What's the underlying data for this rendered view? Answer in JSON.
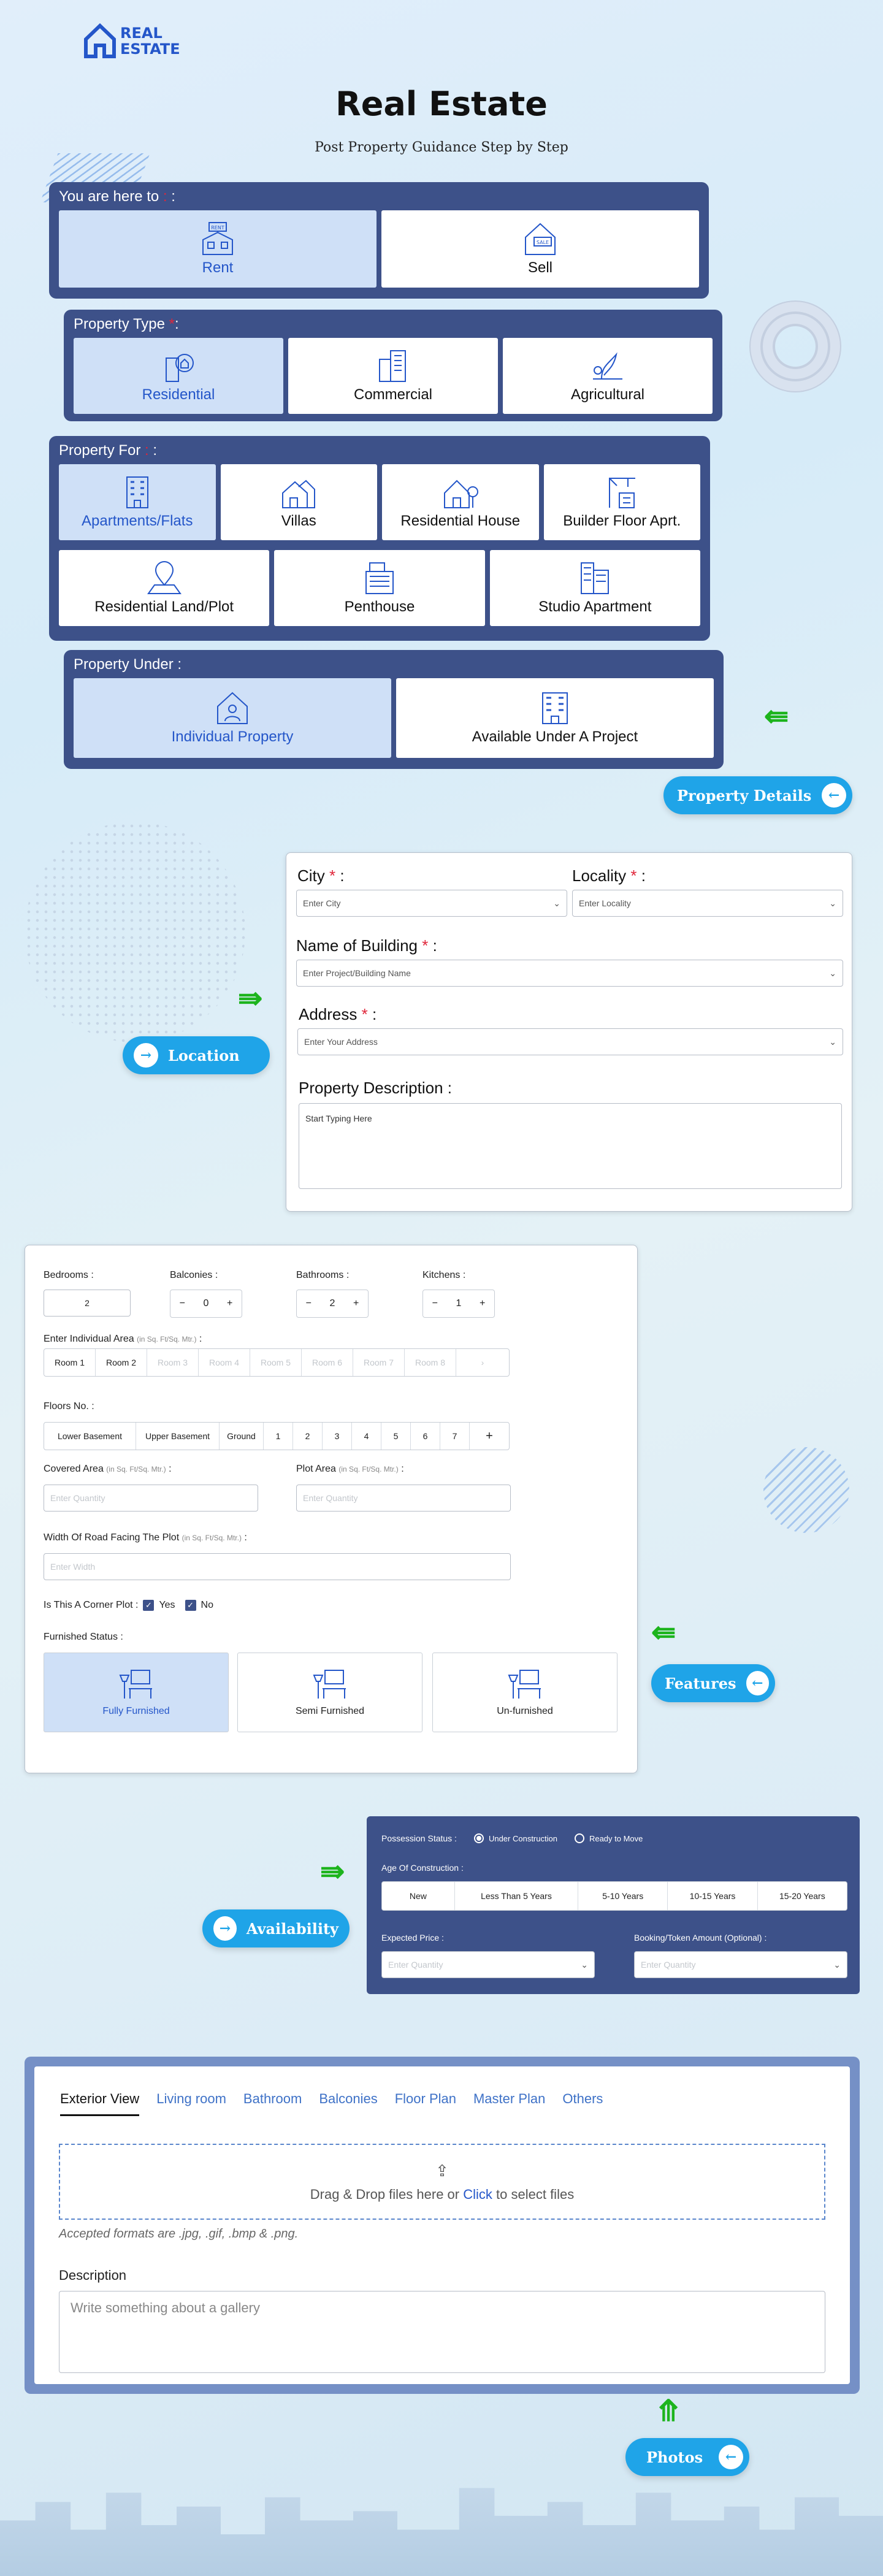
{
  "brand": {
    "line1": "REAL",
    "line2": "ESTATE"
  },
  "hero": {
    "title": "Real Estate",
    "subtitle": "Post Property Guidance Step by Step"
  },
  "step1": {
    "title": "You are here to",
    "options": [
      {
        "label": "Rent",
        "icon": "rent-sign-icon",
        "selected": true
      },
      {
        "label": "Sell",
        "icon": "sale-house-icon",
        "selected": false
      }
    ]
  },
  "step2": {
    "title": "Property Type",
    "options": [
      {
        "label": "Residential",
        "icon": "residential-building-icon",
        "selected": true
      },
      {
        "label": "Commercial",
        "icon": "office-building-icon",
        "selected": false
      },
      {
        "label": "Agricultural",
        "icon": "plant-icon",
        "selected": false
      }
    ]
  },
  "step3": {
    "title": "Property For",
    "options": [
      {
        "label": "Apartments/Flats",
        "selected": true
      },
      {
        "label": "Villas"
      },
      {
        "label": "Residential House"
      },
      {
        "label": "Builder Floor Aprt."
      },
      {
        "label": "Residential Land/Plot"
      },
      {
        "label": "Penthouse"
      },
      {
        "label": "Studio Apartment"
      }
    ]
  },
  "step4": {
    "title": "Property Under :",
    "options": [
      {
        "label": "Individual Property",
        "selected": true
      },
      {
        "label": "Available Under A Project"
      }
    ]
  },
  "buttons": {
    "property_details": "Property Details",
    "location": "Location",
    "features": "Features",
    "availability": "Availability",
    "photos": "Photos"
  },
  "location": {
    "city_label": "City",
    "city_placeholder": "Enter City",
    "locality_label": "Locality",
    "locality_placeholder": "Enter Locality",
    "building_label": "Name of Building",
    "building_placeholder": "Enter Project/Building Name",
    "address_label": "Address",
    "address_placeholder": "Enter Your Address",
    "desc_label": "Property Description :",
    "desc_placeholder": "Start Typing Here"
  },
  "features": {
    "bedrooms_label": "Bedrooms :",
    "bedrooms_value": "2",
    "balconies_label": "Balconies :",
    "balconies_value": "0",
    "bathrooms_label": "Bathrooms :",
    "bathrooms_value": "2",
    "kitchens_label": "Kitchens :",
    "kitchens_value": "1",
    "area_label": "Enter Individual Area",
    "area_unit": "(in Sq. Ft/Sq. Mtr.)",
    "rooms": [
      "Room 1",
      "Room 2",
      "Room 3",
      "Room 4",
      "Room 5",
      "Room 6",
      "Room 7",
      "Room 8"
    ],
    "floors_label": "Floors No. :",
    "floors": [
      "Lower Basement",
      "Upper Basement",
      "Ground",
      "1",
      "2",
      "3",
      "4",
      "5",
      "6",
      "7"
    ],
    "covered_label": "Covered Area",
    "covered_unit": "(in Sq. Ft/Sq. Mtr.)",
    "covered_placeholder": "Enter Quantity",
    "plot_label": "Plot Area",
    "plot_unit": "(in Sq. Ft/Sq. Mtr.)",
    "plot_placeholder": "Enter Quantity",
    "road_label": "Width Of Road Facing The Plot",
    "road_unit": "(in Sq. Ft/Sq. Mtr.)",
    "road_placeholder": "Enter Width",
    "corner_label": "Is This A Corner Plot :",
    "yes": "Yes",
    "no": "No",
    "furnished_label": "Furnished Status :",
    "furnished": [
      {
        "label": "Fully Furnished",
        "selected": true
      },
      {
        "label": "Semi Furnished"
      },
      {
        "label": "Un-furnished"
      }
    ]
  },
  "availability": {
    "possession_label": "Possession Status :",
    "under_construction": "Under Construction",
    "ready": "Ready to Move",
    "age_label": "Age Of Construction :",
    "ages": [
      "New",
      "Less Than 5 Years",
      "5-10 Years",
      "10-15 Years",
      "15-20 Years"
    ],
    "price_label": "Expected Price :",
    "price_placeholder": "Enter Quantity",
    "booking_label": "Booking/Token Amount (Optional) :",
    "booking_placeholder": "Enter Quantity"
  },
  "photos": {
    "tabs": [
      "Exterior View",
      "Living room",
      "Bathroom",
      "Balconies",
      "Floor Plan",
      "Master Plan",
      "Others"
    ],
    "drop_text": "Drag & Drop files here or",
    "click": "Click",
    "drop_suffix": "to select files",
    "formats": "Accepted formats are .jpg, .gif, .bmp & .png.",
    "desc_label": "Description",
    "desc_placeholder": "Write something about a gallery"
  }
}
